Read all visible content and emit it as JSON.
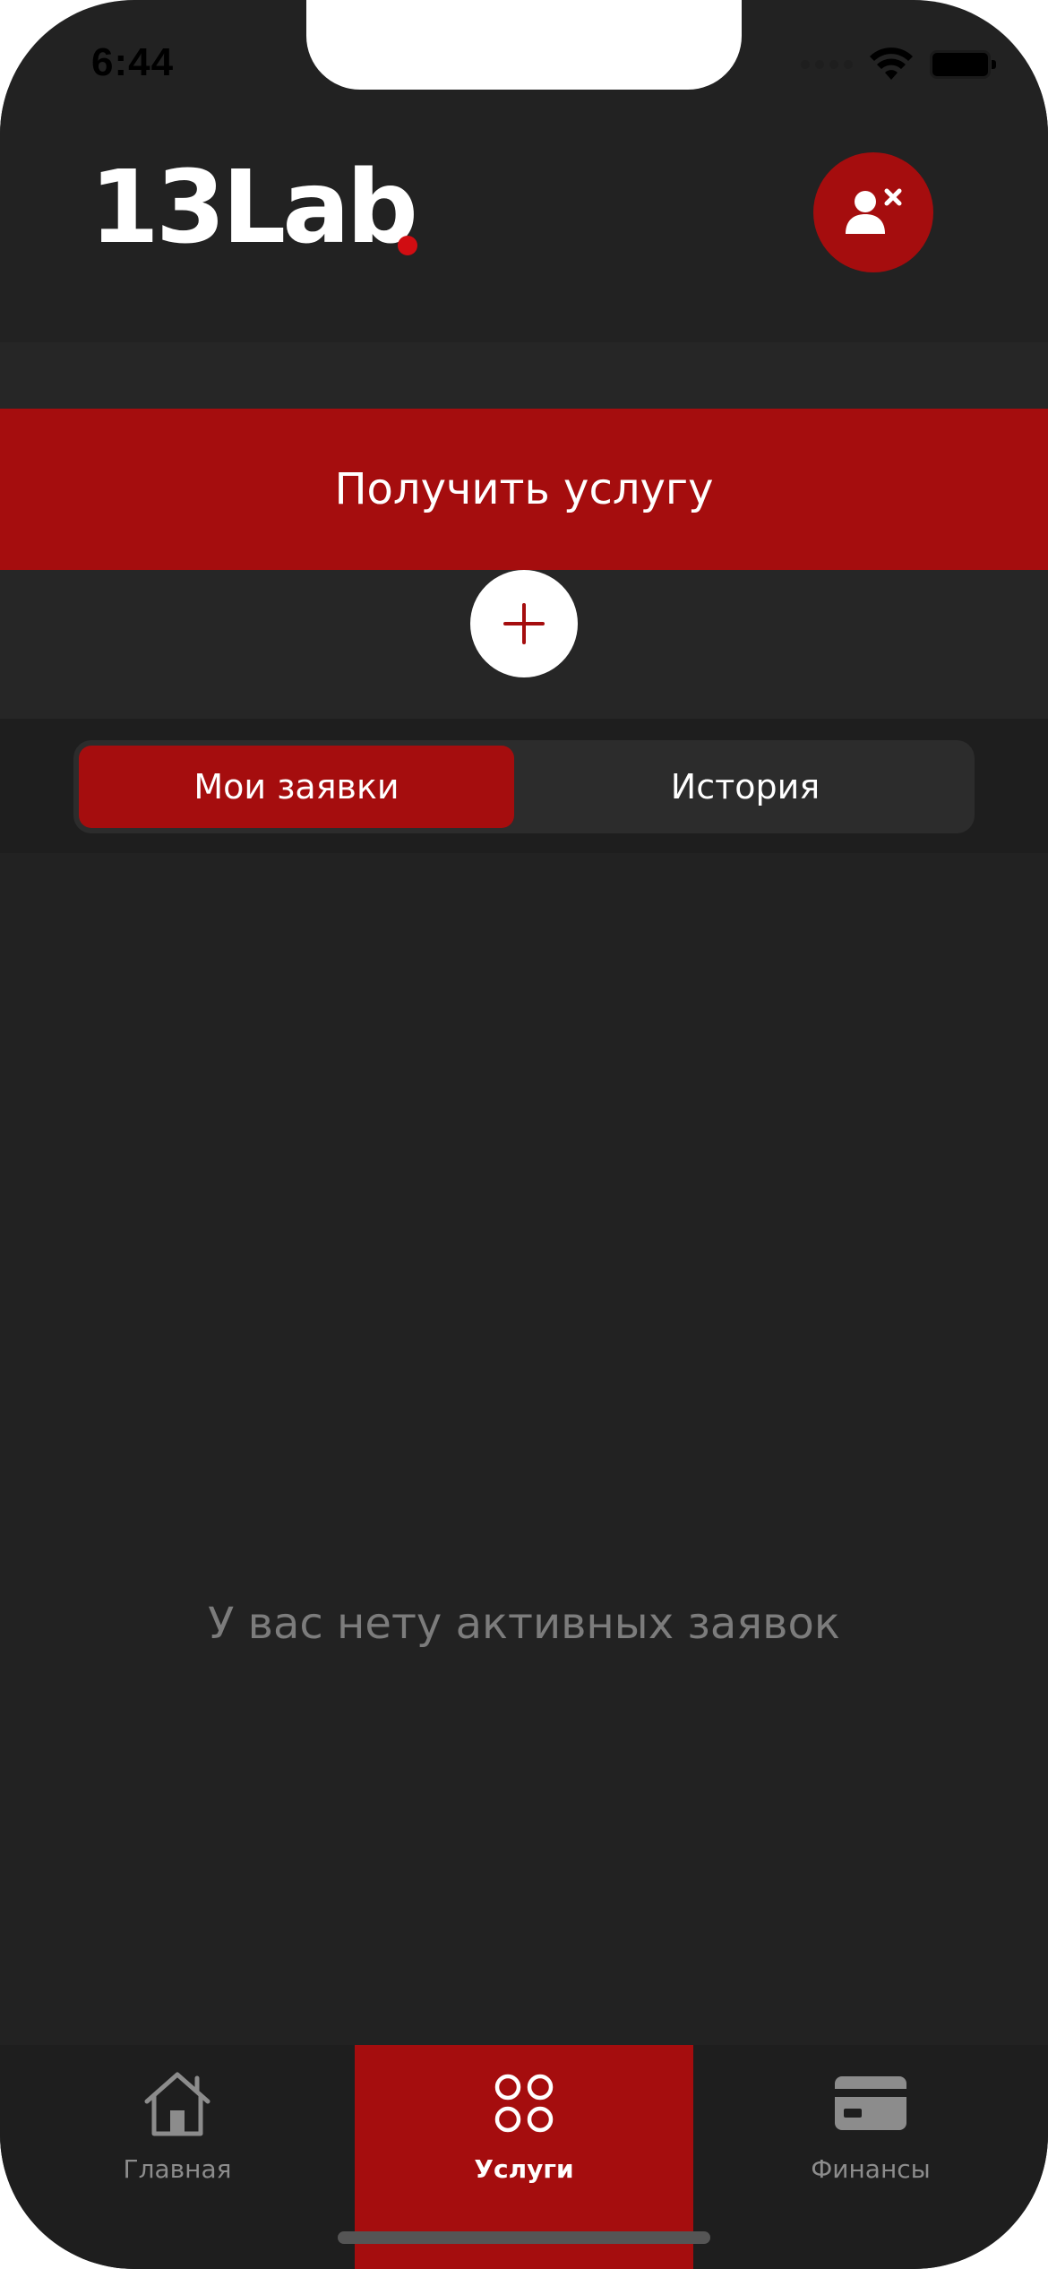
{
  "status_bar": {
    "time": "6:44",
    "wifi_icon": "wifi-icon",
    "battery_icon": "battery-icon"
  },
  "header": {
    "logo_text": "13Lab",
    "profile_icon": "user-remove-icon"
  },
  "actions": {
    "get_service_label": "Получить услугу",
    "add_icon": "plus-icon"
  },
  "tabs": [
    {
      "label": "Мои заявки",
      "active": true
    },
    {
      "label": "История",
      "active": false
    }
  ],
  "main": {
    "empty_message": "У вас нету активных заявок"
  },
  "bottom_nav": [
    {
      "label": "Главная",
      "icon": "home-icon",
      "active": false
    },
    {
      "label": "Услуги",
      "icon": "services-grid-icon",
      "active": true
    },
    {
      "label": "Финансы",
      "icon": "card-icon",
      "active": false
    }
  ],
  "colors": {
    "accent": "#a50d0e",
    "background": "#222222",
    "muted_text": "#7c7c7c"
  }
}
